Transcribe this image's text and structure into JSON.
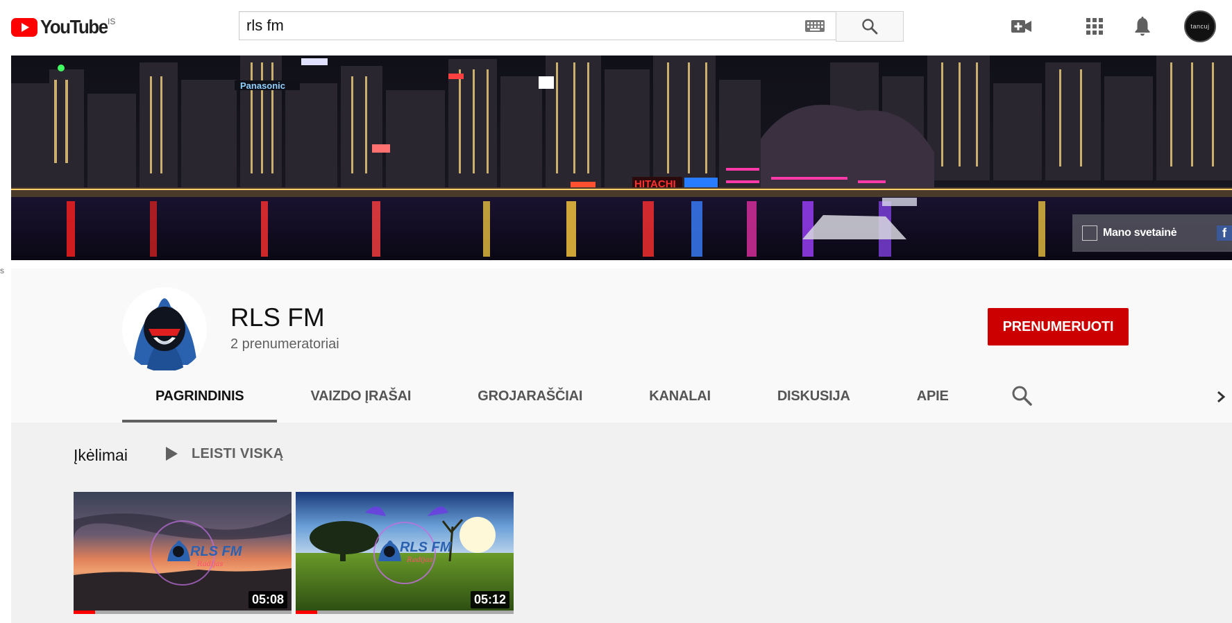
{
  "masthead": {
    "logo_text": "YouTube",
    "country_code": "IS",
    "search": {
      "value": "rls fm",
      "placeholder": ""
    },
    "avatar_text": "tancuj"
  },
  "edge_text": "s",
  "banner": {
    "sign_1": "Panasonic",
    "sign_2": "HITACHI",
    "link_label": "Mano svetainė",
    "fb_glyph": "f"
  },
  "channel": {
    "name": "RLS FM",
    "subscribers": "2 prenumeratoriai",
    "subscribe_label": "PRENUMERUOTI",
    "tabs": [
      "PAGRINDINIS",
      "VAIZDO ĮRAŠAI",
      "GROJARAŠČIAI",
      "KANALAI",
      "DISKUSIJA",
      "APIE"
    ],
    "active_tab": "PAGRINDINIS"
  },
  "section": {
    "title": "Įkėlimai",
    "play_all_label": "LEISTI VISKĄ"
  },
  "videos": [
    {
      "duration": "05:08",
      "overlay_title": "RLS FM",
      "overlay_sub": "Radijas",
      "watched_percent": 10
    },
    {
      "duration": "05:12",
      "overlay_title": "RLS FM",
      "overlay_sub": "Radijas",
      "watched_percent": 10
    }
  ],
  "colors": {
    "brand_red": "#ff0000",
    "subscribe_red": "#cc0000",
    "header_bg": "#f9f9f9",
    "content_bg": "#f1f1f1",
    "tab_indicator": "#606060"
  },
  "icons": {
    "logo": "youtube-play-icon",
    "keyboard": "keyboard-icon",
    "search": "search-icon",
    "upload": "video-camera-plus-icon",
    "apps": "apps-grid-icon",
    "notifications": "bell-icon",
    "play_all": "play-icon",
    "tabs_next": "chevron-right-icon",
    "website": "website-link-icon",
    "facebook": "facebook-icon"
  }
}
